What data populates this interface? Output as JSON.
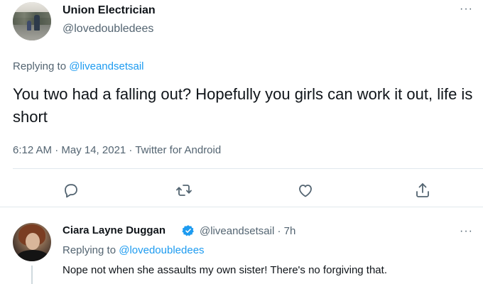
{
  "main_tweet": {
    "author_name": "Union Electrician",
    "author_handle": "@lovedoubledees",
    "more_label": "···",
    "replying_prefix": "Replying to ",
    "replying_to": "@liveandsetsail",
    "text": "You two had a falling out? Hopefully you girls can work it out, life is short",
    "meta": "6:12 AM · May 14, 2021 · Twitter for Android",
    "actions": [
      "reply-icon",
      "retweet-icon",
      "like-icon",
      "share-icon"
    ]
  },
  "reply_tweet": {
    "author_name": "Ciara Layne Duggan",
    "verified": true,
    "handle_time": "@liveandsetsail · 7h",
    "more_label": "···",
    "replying_prefix": "Replying to ",
    "replying_to": "@lovedoubledees",
    "text": "Nope not when she assaults my own sister! There's no forgiving that."
  },
  "colors": {
    "accent": "#1d9bf0",
    "secondary_text": "#536471",
    "primary_text": "#0f1419",
    "divider": "#e1e8ed"
  }
}
